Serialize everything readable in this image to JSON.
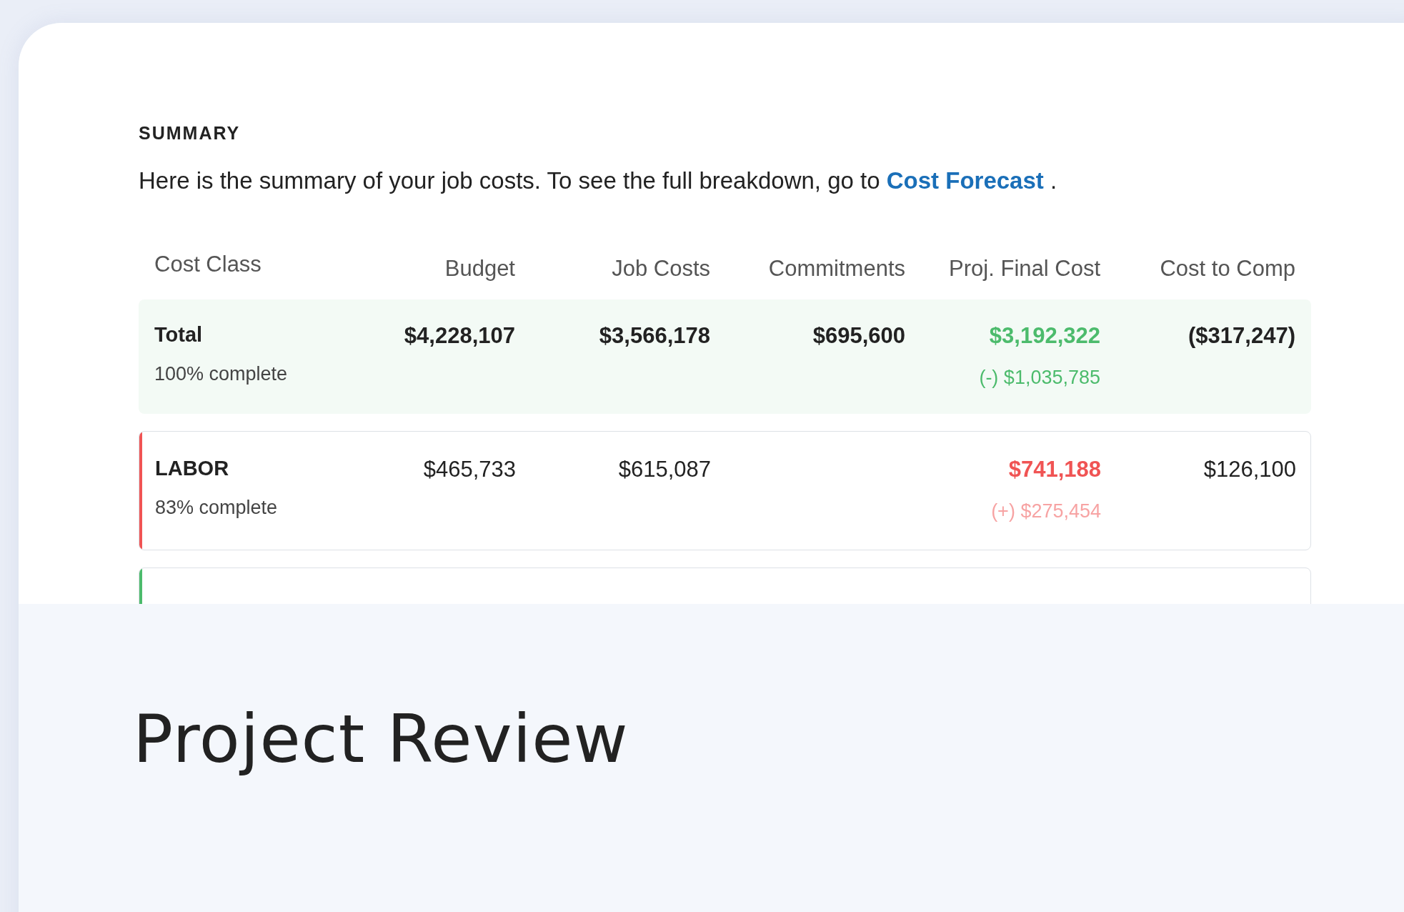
{
  "summary": {
    "heading": "SUMMARY",
    "text": "Here is the summary of your job costs. To see the full breakdown, go to",
    "link": "Cost Forecast",
    "after": "."
  },
  "table": {
    "columns": [
      "Cost Class",
      "Budget",
      "Job Costs",
      "Commitments",
      "Proj. Final Cost",
      "Cost to Comp"
    ],
    "rows": [
      {
        "kind": "total",
        "name": "Total",
        "progress": "100% complete",
        "budget": "$4,228,107",
        "job_costs": "$3,566,178",
        "commitments": "$695,600",
        "final_cost": "$3,192,322",
        "variance": "(-) $1,035,785",
        "over_budget": false,
        "cost_to_comp": "($317,247)"
      },
      {
        "kind": "class",
        "color": "#f05454",
        "name": "LABOR",
        "progress": "83% complete",
        "budget": "$465,733",
        "job_costs": "$615,087",
        "final_cost": "$741,188",
        "variance": "(+) $275,454",
        "over_budget": true,
        "cost_to_comp": "$126,100"
      },
      {
        "kind": "class",
        "color": "#4cbb6c"
      }
    ]
  },
  "caption": "Project Review"
}
